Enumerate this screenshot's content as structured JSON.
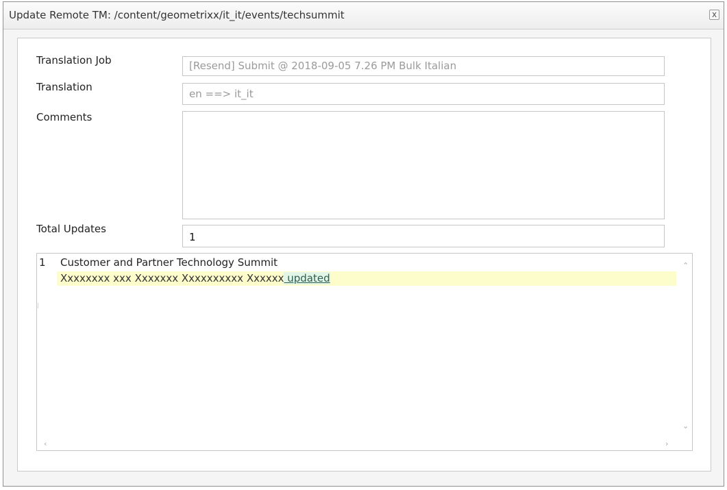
{
  "dialog": {
    "title": "Update Remote TM: /content/geometrixx/it_it/events/techsummit",
    "close_label": "x"
  },
  "form": {
    "translation_job": {
      "label": "Translation Job",
      "value": "[Resend] Submit @ 2018-09-05 7.26 PM Bulk Italian"
    },
    "translation": {
      "label": "Translation",
      "value": "en  ==> it_it"
    },
    "comments": {
      "label": "Comments",
      "value": ""
    },
    "total_updates": {
      "label": "Total Updates",
      "value": "1"
    }
  },
  "updates": [
    {
      "index": "1",
      "original": "Customer and Partner Technology Summit",
      "updated_base": "Xxxxxxxx xxx Xxxxxxx Xxxxxxxxxx Xxxxxx",
      "updated_suffix": " updated"
    }
  ],
  "icons": {
    "close": "close-icon",
    "scroll_up": "chevron-up-icon",
    "scroll_down": "chevron-down-icon",
    "scroll_left": "chevron-left-icon",
    "scroll_right": "chevron-right-icon"
  },
  "colors": {
    "updated_highlight": "#fdfccb",
    "updated_suffix": "#e3f5e6",
    "readonly_text": "#9a9a9a"
  }
}
